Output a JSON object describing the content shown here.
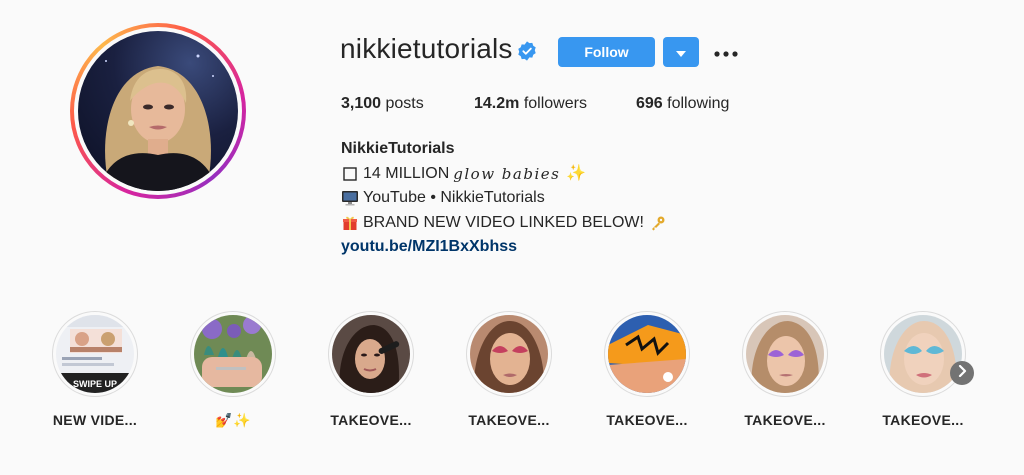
{
  "profile": {
    "username": "nikkietutorials",
    "verified": true,
    "follow_label": "Follow",
    "accent_color": "#3897f0",
    "verified_color": "#3897f0",
    "link_color": "#003569"
  },
  "stats": {
    "posts_count": "3,100",
    "posts_label": "posts",
    "followers_count": "14.2m",
    "followers_label": "followers",
    "following_count": "696",
    "following_label": "following"
  },
  "bio": {
    "name": "NikkieTutorials",
    "line1_prefix": "14 MILLION",
    "line1_styled": "glow babies",
    "line1_suffix": "✨",
    "line2_text": "YouTube • NikkieTutorials",
    "line3_text": "BRAND NEW VIDEO LINKED BELOW!",
    "link": "youtu.be/MZI1BxXbhss"
  },
  "icons": {
    "line1": "white-square-icon",
    "line2": "desktop-computer-icon",
    "line3": "gift-icon",
    "line3_end": "key-icon"
  },
  "highlights": [
    {
      "label": "NEW VIDE..."
    },
    {
      "label": "💅✨"
    },
    {
      "label": "TAKEOVE..."
    },
    {
      "label": "TAKEOVE..."
    },
    {
      "label": "TAKEOVE..."
    },
    {
      "label": "TAKEOVE..."
    },
    {
      "label": "TAKEOVE..."
    }
  ]
}
